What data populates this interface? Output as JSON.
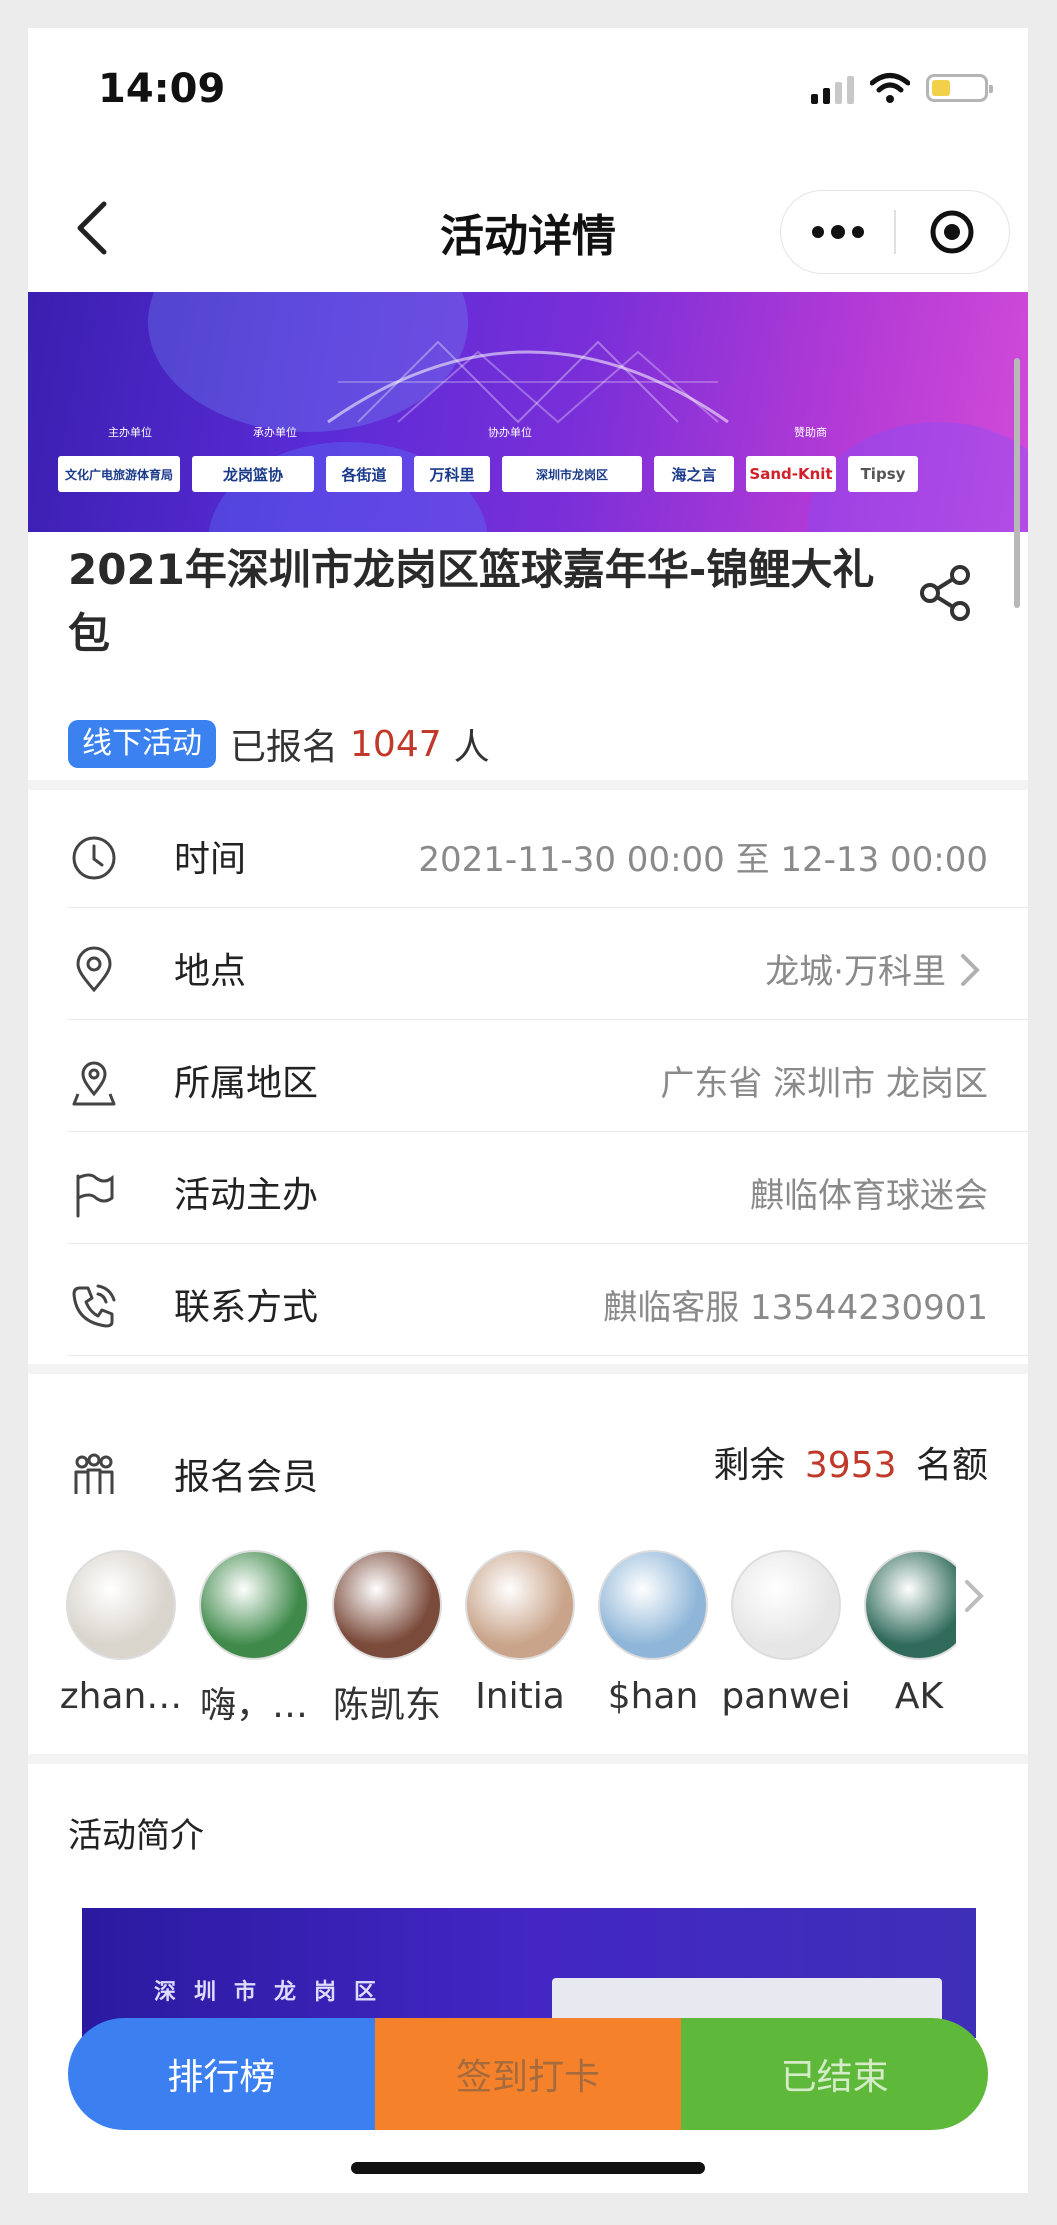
{
  "status_bar": {
    "time": "14:09"
  },
  "nav": {
    "title": "活动详情"
  },
  "event": {
    "title": "2021年深圳市龙岗区篮球嘉年华-锦鲤大礼包",
    "tag": "线下活动",
    "registered_prefix": "已报名",
    "registered_count": "1047",
    "registered_suffix": "人"
  },
  "banner": {
    "captions": [
      "主办单位",
      "承办单位",
      "协办单位",
      "赞助商"
    ],
    "logos": [
      "文化广电旅游体育局",
      "龙岗篮协",
      "各街道",
      "万科里",
      "深圳市龙岗区",
      "海之言",
      "Sand-Knit",
      "Tipsy"
    ]
  },
  "info_rows": [
    {
      "label": "时间",
      "value": "2021-11-30 00:00 至 12-13 00:00",
      "icon": "clock-icon"
    },
    {
      "label": "地点",
      "value": "龙城·万科里",
      "icon": "location-pin-icon"
    },
    {
      "label": "所属地区",
      "value": "广东省 深圳市 龙岗区",
      "icon": "map-pin-icon"
    },
    {
      "label": "活动主办",
      "value": "麒临体育球迷会",
      "icon": "flag-icon"
    },
    {
      "label": "联系方式",
      "value": "麒临客服 13544230901",
      "icon": "phone-icon"
    }
  ],
  "members": {
    "label": "报名会员",
    "quota_prefix": "剩余",
    "quota_count": "3953",
    "quota_suffix": "名额",
    "list": [
      {
        "name": "zhan…",
        "color": "#d9d4cc"
      },
      {
        "name": "嗨，…",
        "color": "#3f8a4b"
      },
      {
        "name": "陈凯东",
        "color": "#7a4a3a"
      },
      {
        "name": "Initia",
        "color": "#c9a48a"
      },
      {
        "name": "$han",
        "color": "#8fb6d8"
      },
      {
        "name": "panwei",
        "color": "#e6e6e6"
      },
      {
        "name": "AK",
        "color": "#2f6a5a"
      }
    ]
  },
  "intro": {
    "label": "活动简介",
    "image_text": "深圳市龙岗区"
  },
  "actions": {
    "rank": "排行榜",
    "checkin": "签到打卡",
    "ended": "已结束"
  },
  "colors": {
    "accent_blue": "#3b7ff0",
    "orange": "#f5822a",
    "green": "#5eb83a",
    "highlight_red": "#c0392b"
  }
}
